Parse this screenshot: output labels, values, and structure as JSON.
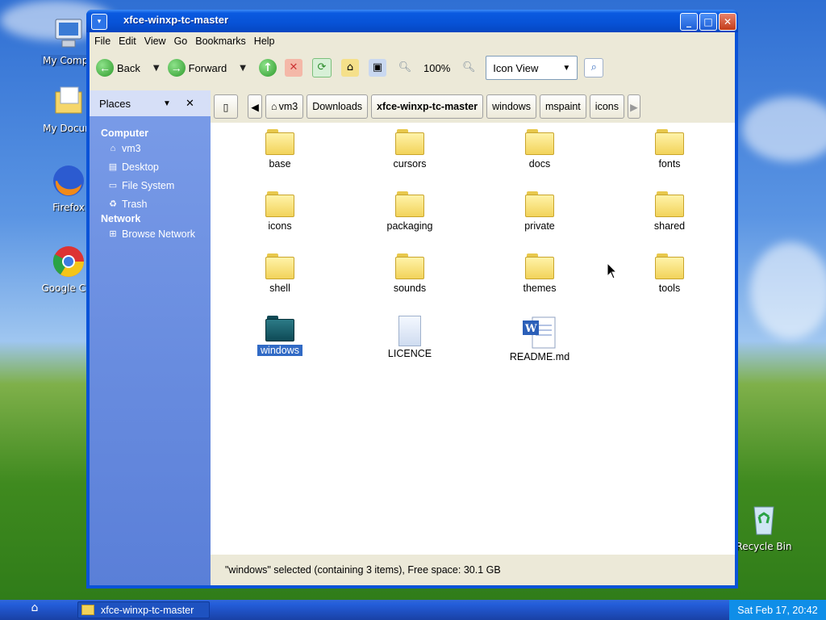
{
  "desktop": {
    "icons": [
      {
        "label": "My Compu",
        "icon": "my-computer-icon"
      },
      {
        "label": "My Docum",
        "icon": "my-documents-icon"
      },
      {
        "label": "Firefox",
        "icon": "firefox-icon"
      },
      {
        "label": "Google Chr",
        "icon": "chrome-icon"
      },
      {
        "label": "Recycle Bin",
        "icon": "recycle-bin-icon"
      }
    ]
  },
  "window": {
    "title": "xfce-winxp-tc-master",
    "menu": [
      "File",
      "Edit",
      "View",
      "Go",
      "Bookmarks",
      "Help"
    ],
    "toolbar": {
      "back": "Back",
      "forward": "Forward",
      "zoom": "100%",
      "view_mode": "Icon View"
    },
    "sidebar": {
      "title": "Places",
      "sections": [
        {
          "label": "Computer",
          "items": [
            {
              "label": "vm3",
              "icon": "home-icon"
            },
            {
              "label": "Desktop",
              "icon": "desktop-icon"
            },
            {
              "label": "File System",
              "icon": "drive-icon"
            },
            {
              "label": "Trash",
              "icon": "trash-icon"
            }
          ]
        },
        {
          "label": "Network",
          "items": [
            {
              "label": "Browse Network",
              "icon": "network-icon"
            }
          ]
        }
      ]
    },
    "breadcrumb": [
      "vm3",
      "Downloads",
      "xfce-winxp-tc-master",
      "windows",
      "mspaint",
      "icons"
    ],
    "files": [
      {
        "name": "base",
        "type": "folder"
      },
      {
        "name": "cursors",
        "type": "folder"
      },
      {
        "name": "docs",
        "type": "folder"
      },
      {
        "name": "fonts",
        "type": "folder"
      },
      {
        "name": "icons",
        "type": "folder"
      },
      {
        "name": "packaging",
        "type": "folder"
      },
      {
        "name": "private",
        "type": "folder"
      },
      {
        "name": "shared",
        "type": "folder"
      },
      {
        "name": "shell",
        "type": "folder"
      },
      {
        "name": "sounds",
        "type": "folder"
      },
      {
        "name": "themes",
        "type": "folder"
      },
      {
        "name": "tools",
        "type": "folder"
      },
      {
        "name": "windows",
        "type": "folder-selected"
      },
      {
        "name": "LICENCE",
        "type": "document"
      },
      {
        "name": "README.md",
        "type": "word-document"
      }
    ],
    "status": "\"windows\" selected (containing 3 items), Free space: 30.1 GB"
  },
  "taskbar": {
    "task": "xfce-winxp-tc-master",
    "clock": "Sat Feb 17, 20:42"
  }
}
